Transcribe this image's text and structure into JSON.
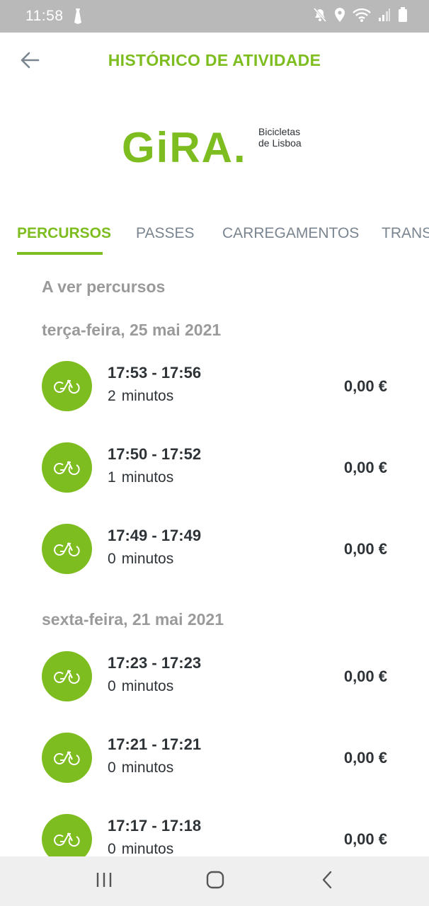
{
  "status_bar": {
    "time": "11:58",
    "icons": [
      "tie-icon",
      "mute-icon",
      "location-icon",
      "wifi-icon",
      "signal-icon",
      "battery-icon"
    ]
  },
  "header": {
    "title": "HISTÓRICO DE ATIVIDADE",
    "back_icon": "arrow-left-icon"
  },
  "logo": {
    "brand": "GiRA.",
    "tagline_line1": "Bicicletas",
    "tagline_line2": "de Lisboa"
  },
  "tabs": [
    {
      "label": "PERCURSOS",
      "active": true
    },
    {
      "label": "PASSES",
      "active": false
    },
    {
      "label": "CARREGAMENTOS",
      "active": false
    },
    {
      "label": "TRANS",
      "active": false
    }
  ],
  "list": {
    "caption": "A ver percursos",
    "groups": [
      {
        "date": "terça-feira, 25 mai 2021",
        "trips": [
          {
            "time": "17:53 - 17:56",
            "duration_value": "2",
            "duration_unit": "minutos",
            "price": "0,00 €"
          },
          {
            "time": "17:50 - 17:52",
            "duration_value": "1",
            "duration_unit": "minutos",
            "price": "0,00 €"
          },
          {
            "time": "17:49 - 17:49",
            "duration_value": "0",
            "duration_unit": "minutos",
            "price": "0,00 €"
          }
        ]
      },
      {
        "date": "sexta-feira, 21 mai 2021",
        "trips": [
          {
            "time": "17:23 - 17:23",
            "duration_value": "0",
            "duration_unit": "minutos",
            "price": "0,00 €"
          },
          {
            "time": "17:21 - 17:21",
            "duration_value": "0",
            "duration_unit": "minutos",
            "price": "0,00 €"
          },
          {
            "time": "17:17 - 17:18",
            "duration_value": "0",
            "duration_unit": "minutos",
            "price": "0,00 €"
          }
        ]
      }
    ]
  },
  "colors": {
    "accent": "#7ebd1f",
    "status_bar": "#b9b9b9",
    "text_dark": "#2e3338",
    "text_muted": "#9a9a9a",
    "tab_inactive": "#7a8590"
  },
  "nav_bar": {
    "icons": [
      "recents-icon",
      "home-icon",
      "back-icon"
    ]
  }
}
